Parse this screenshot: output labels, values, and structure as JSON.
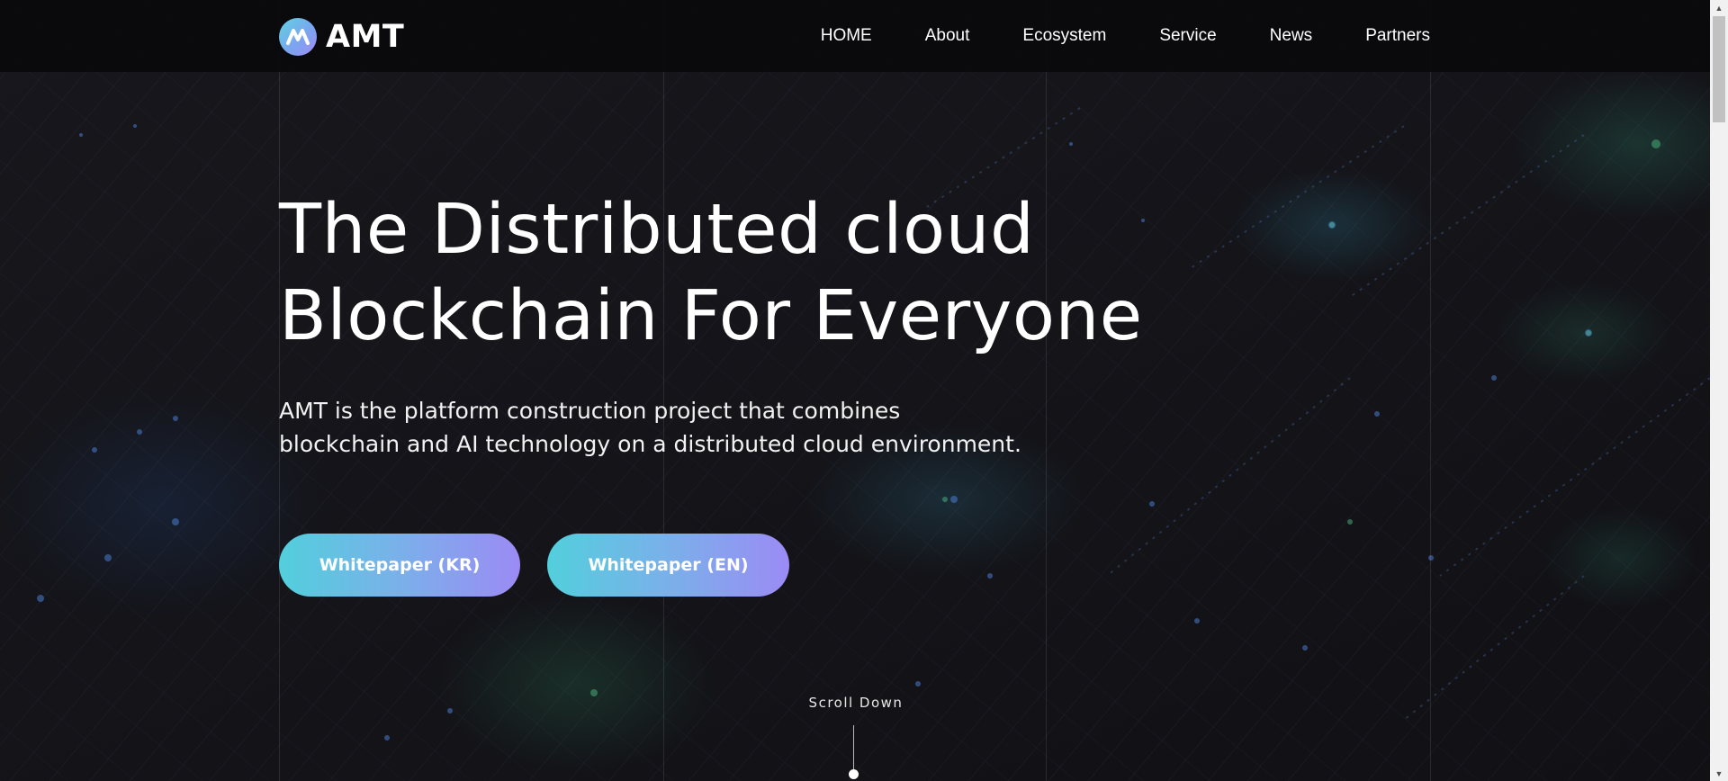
{
  "header": {
    "logo_text": "AMT",
    "nav": [
      {
        "label": "HOME"
      },
      {
        "label": "About"
      },
      {
        "label": "Ecosystem"
      },
      {
        "label": "Service"
      },
      {
        "label": "News"
      },
      {
        "label": "Partners"
      }
    ]
  },
  "hero": {
    "title_line1": "The Distributed cloud",
    "title_line2": "Blockchain For Everyone",
    "desc_line1": "AMT is the platform construction project that combines",
    "desc_line2": "blockchain and AI technology on a distributed cloud environment.",
    "buttons": {
      "kr": "Whitepaper (KR)",
      "en": "Whitepaper (EN)"
    },
    "scroll_label": "Scroll Down"
  },
  "colors": {
    "background": "#121216",
    "button_gradient_start": "#52cfdc",
    "button_gradient_end": "#9b8bf4",
    "text": "#ffffff"
  },
  "icons": {
    "logo": "amt-logo-icon",
    "scroll_up": "scroll-up-arrow-icon",
    "scroll_down": "scroll-down-arrow-icon"
  }
}
